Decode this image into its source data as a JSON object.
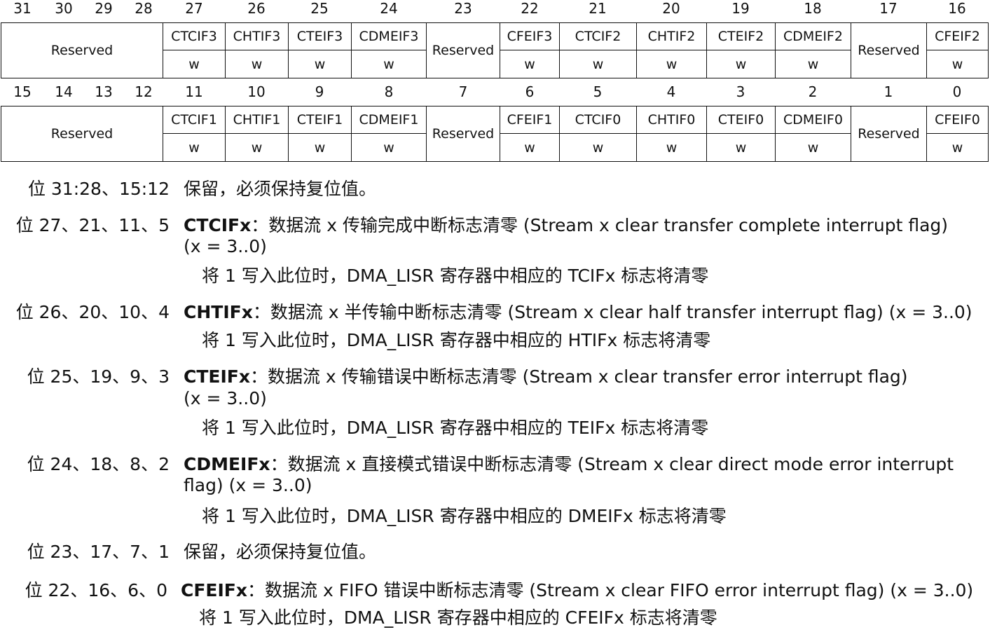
{
  "register": {
    "upper_bits": [
      "31",
      "30",
      "29",
      "28",
      "27",
      "26",
      "25",
      "24",
      "23",
      "22",
      "21",
      "20",
      "19",
      "18",
      "17",
      "16"
    ],
    "lower_bits": [
      "15",
      "14",
      "13",
      "12",
      "11",
      "10",
      "9",
      "8",
      "7",
      "6",
      "5",
      "4",
      "3",
      "2",
      "1",
      "0"
    ],
    "upper_fields": [
      {
        "name": "Reserved",
        "access": ""
      },
      {
        "name": "CTCIF3",
        "access": "w"
      },
      {
        "name": "CHTIF3",
        "access": "w"
      },
      {
        "name": "CTEIF3",
        "access": "w"
      },
      {
        "name": "CDMEIF3",
        "access": "w"
      },
      {
        "name": "Reserved",
        "access": ""
      },
      {
        "name": "CFEIF3",
        "access": "w"
      },
      {
        "name": "CTCIF2",
        "access": "w"
      },
      {
        "name": "CHTIF2",
        "access": "w"
      },
      {
        "name": "CTEIF2",
        "access": "w"
      },
      {
        "name": "CDMEIF2",
        "access": "w"
      },
      {
        "name": "Reserved",
        "access": ""
      },
      {
        "name": "CFEIF2",
        "access": "w"
      }
    ],
    "lower_fields": [
      {
        "name": "Reserved",
        "access": ""
      },
      {
        "name": "CTCIF1",
        "access": "w"
      },
      {
        "name": "CHTIF1",
        "access": "w"
      },
      {
        "name": "CTEIF1",
        "access": "w"
      },
      {
        "name": "CDMEIF1",
        "access": "w"
      },
      {
        "name": "Reserved",
        "access": ""
      },
      {
        "name": "CFEIF1",
        "access": "w"
      },
      {
        "name": "CTCIF0",
        "access": "w"
      },
      {
        "name": "CHTIF0",
        "access": "w"
      },
      {
        "name": "CTEIF0",
        "access": "w"
      },
      {
        "name": "CDMEIF0",
        "access": "w"
      },
      {
        "name": "Reserved",
        "access": ""
      },
      {
        "name": "CFEIF0",
        "access": "w"
      }
    ]
  },
  "descriptions": [
    {
      "bits": "位 31:28、15:12",
      "name": "",
      "lines": [
        "保留，必须保持复位值。"
      ],
      "detail": ""
    },
    {
      "bits": "位 27、21、11、5",
      "name": "CTCIFx",
      "lines": [
        "：数据流 x 传输完成中断标志清零 (Stream x clear transfer complete interrupt flag)",
        "(x = 3..0)"
      ],
      "detail": "将 1 写入此位时，DMA_LISR 寄存器中相应的 TCIFx 标志将清零"
    },
    {
      "bits": "位 26、20、10、4",
      "name": "CHTIFx",
      "lines": [
        "：数据流 x 半传输中断标志清零 (Stream x clear half transfer interrupt flag) (x = 3..0)"
      ],
      "detail": "将 1 写入此位时，DMA_LISR 寄存器中相应的 HTIFx 标志将清零"
    },
    {
      "bits": "位 25、19、9、3",
      "name": "CTEIFx",
      "lines": [
        "：数据流 x 传输错误中断标志清零 (Stream x clear transfer error interrupt flag)",
        "(x = 3..0)"
      ],
      "detail": "将 1 写入此位时，DMA_LISR 寄存器中相应的 TEIFx 标志将清零"
    },
    {
      "bits": "位 24、18、8、2",
      "name": "CDMEIFx",
      "lines": [
        "：数据流 x 直接模式错误中断标志清零 (Stream x clear direct mode error interrupt",
        "flag) (x = 3..0)"
      ],
      "detail": "将 1 写入此位时，DMA_LISR 寄存器中相应的 DMEIFx 标志将清零"
    },
    {
      "bits": "位 23、17、7、1",
      "name": "",
      "lines": [
        "保留，必须保持复位值。"
      ],
      "detail": ""
    },
    {
      "bits": "位 22、16、6、0",
      "name": "CFEIFx",
      "lines": [
        "：数据流 x FIFO 错误中断标志清零 (Stream x clear FIFO error interrupt flag) (x = 3..0)"
      ],
      "detail": "将 1 写入此位时，DMA_LISR 寄存器中相应的 CFEIFx 标志将清零"
    }
  ]
}
